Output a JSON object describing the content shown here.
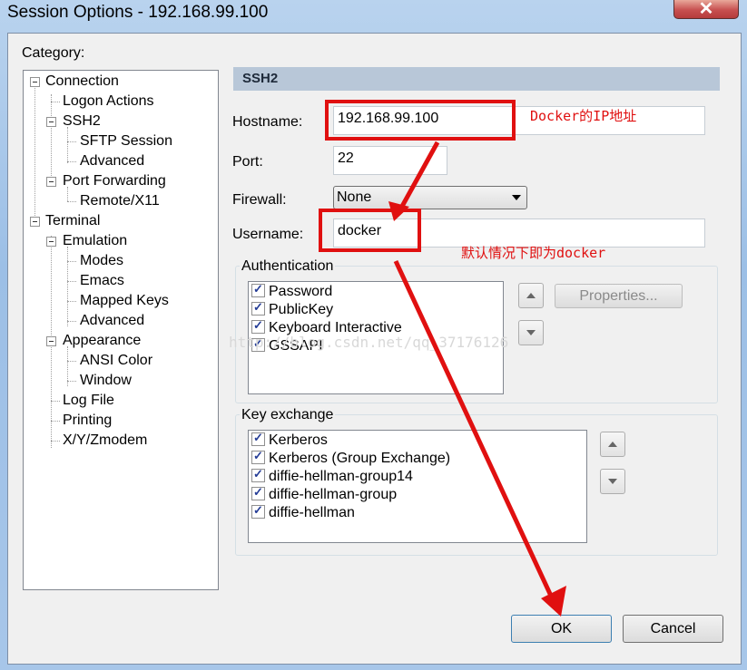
{
  "window": {
    "title": "Session Options - 192.168.99.100",
    "close_label": "✕"
  },
  "category_label": "Category:",
  "tree": [
    {
      "label": "Connection"
    },
    {
      "label": "Logon Actions"
    },
    {
      "label": "SSH2"
    },
    {
      "label": "SFTP Session"
    },
    {
      "label": "Advanced"
    },
    {
      "label": "Port Forwarding"
    },
    {
      "label": "Remote/X11"
    },
    {
      "label": "Terminal"
    },
    {
      "label": "Emulation"
    },
    {
      "label": "Modes"
    },
    {
      "label": "Emacs"
    },
    {
      "label": "Mapped Keys"
    },
    {
      "label": "Advanced"
    },
    {
      "label": "Appearance"
    },
    {
      "label": "ANSI Color"
    },
    {
      "label": "Window"
    },
    {
      "label": "Log File"
    },
    {
      "label": "Printing"
    },
    {
      "label": "X/Y/Zmodem"
    }
  ],
  "panel": {
    "header": "SSH2",
    "hostname_label": "Hostname:",
    "hostname_value": "192.168.99.100",
    "port_label": "Port:",
    "port_value": "22",
    "firewall_label": "Firewall:",
    "firewall_value": "None",
    "username_label": "Username:",
    "username_value": "docker"
  },
  "authentication": {
    "title": "Authentication",
    "items": [
      "Password",
      "PublicKey",
      "Keyboard Interactive",
      "GSSAPI"
    ],
    "properties_label": "Properties..."
  },
  "key_exchange": {
    "title": "Key exchange",
    "items": [
      "Kerberos",
      "Kerberos (Group Exchange)",
      "diffie-hellman-group14",
      "diffie-hellman-group",
      "diffie-hellman"
    ]
  },
  "buttons": {
    "ok": "OK",
    "cancel": "Cancel"
  },
  "annotations": {
    "hostname_note": "Docker的IP地址",
    "username_note": "默认情况下即为docker",
    "color": "#e01010"
  },
  "watermark": "http://blog.csdn.net/qq_37176126"
}
